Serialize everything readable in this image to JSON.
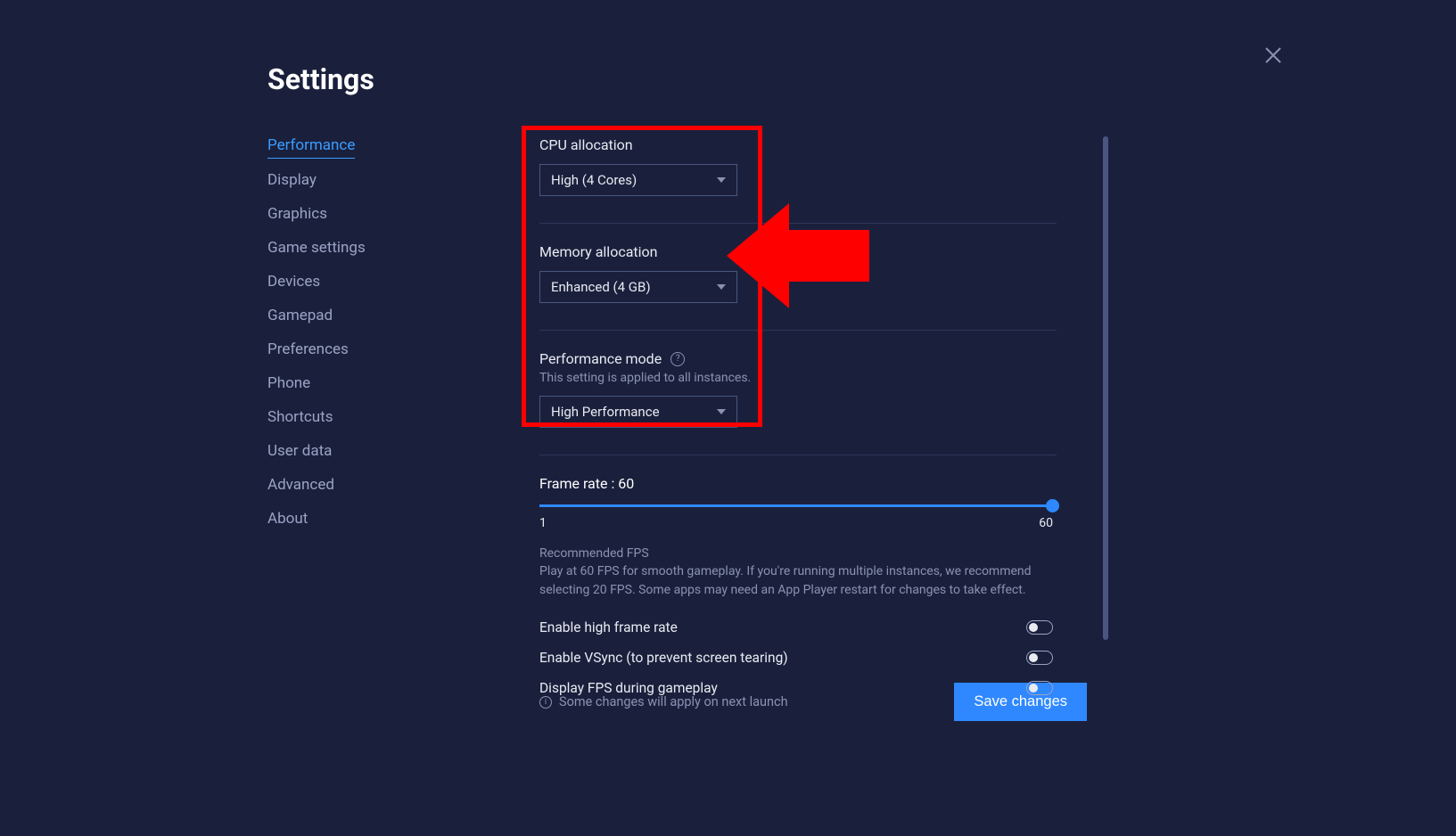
{
  "title": "Settings",
  "sidebar": {
    "items": [
      {
        "label": "Performance",
        "active": true
      },
      {
        "label": "Display"
      },
      {
        "label": "Graphics"
      },
      {
        "label": "Game settings"
      },
      {
        "label": "Devices"
      },
      {
        "label": "Gamepad"
      },
      {
        "label": "Preferences"
      },
      {
        "label": "Phone"
      },
      {
        "label": "Shortcuts"
      },
      {
        "label": "User data"
      },
      {
        "label": "Advanced"
      },
      {
        "label": "About"
      }
    ]
  },
  "performance": {
    "cpu": {
      "label": "CPU allocation",
      "value": "High (4 Cores)"
    },
    "memory": {
      "label": "Memory allocation",
      "value": "Enhanced (4 GB)"
    },
    "mode": {
      "label": "Performance mode",
      "hint": "This setting is applied to all instances.",
      "value": "High Performance"
    },
    "framerate": {
      "label": "Frame rate : 60",
      "min": "1",
      "max": "60",
      "value": 60,
      "rec_title": "Recommended FPS",
      "rec_body": "Play at 60 FPS for smooth gameplay. If you're running multiple instances, we recommend selecting 20 FPS. Some apps may need an App Player restart for changes to take effect."
    },
    "toggles": [
      {
        "label": "Enable high frame rate",
        "on": false
      },
      {
        "label": "Enable VSync (to prevent screen tearing)",
        "on": false
      },
      {
        "label": "Display FPS during gameplay",
        "on": false
      }
    ]
  },
  "footer": {
    "note": "Some changes will apply on next launch",
    "save": "Save changes"
  },
  "annotation": {
    "highlight_color": "#ff0000",
    "arrow_color": "#ff0000"
  }
}
